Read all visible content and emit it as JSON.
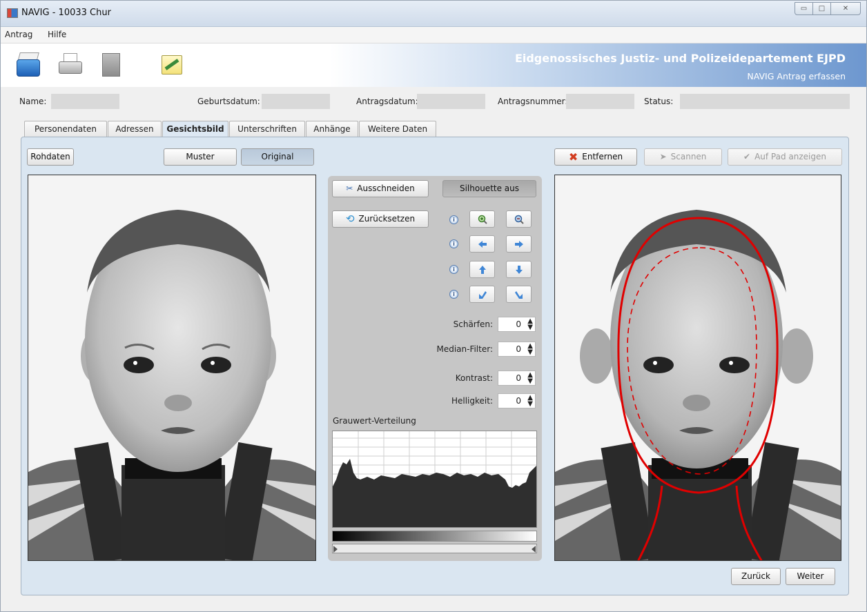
{
  "window": {
    "title": "NAVIG - 10033 Chur"
  },
  "menu": [
    "Antrag",
    "Hilfe"
  ],
  "toolbar": {
    "icons": [
      "new-application-icon",
      "print-icon",
      "document-icon",
      "edit-notes-icon"
    ],
    "banner_title": "Eidgenossisches Justiz- und Polizeidepartement EJPD",
    "banner_subtitle": "NAVIG Antrag erfassen"
  },
  "info": {
    "name_label": "Name:",
    "birth_label": "Geburtsdatum:",
    "appdate_label": "Antragsdatum:",
    "appnum_label": "Antragsnummer:",
    "status_label": "Status:"
  },
  "tabs": [
    "Personendaten",
    "Adressen",
    "Gesichtsbild",
    "Unterschriften",
    "Anhänge",
    "Weitere Daten"
  ],
  "active_tab": "Gesichtsbild",
  "buttons": {
    "rohdaten": "Rohdaten",
    "muster": "Muster",
    "original": "Original",
    "entfernen": "Entfernen",
    "scannen": "Scannen",
    "auf_pad": "Auf Pad anzeigen",
    "ausschneiden": "Ausschneiden",
    "silhouette": "Silhouette aus",
    "zuruecksetzen": "Zurücksetzen",
    "zurueck": "Zurück",
    "weiter": "Weiter"
  },
  "params": {
    "schaerfen_label": "Schärfen:",
    "schaerfen_value": "0",
    "median_label": "Median-Filter:",
    "median_value": "0",
    "kontrast_label": "Kontrast:",
    "kontrast_value": "0",
    "helligkeit_label": "Helligkeit:",
    "helligkeit_value": "0"
  },
  "histogram": {
    "label": "Grauwert-Verteilung"
  },
  "colors": {
    "accent": "#6d97cf",
    "panel": "#dae6f1",
    "overlay": "#e00000"
  }
}
